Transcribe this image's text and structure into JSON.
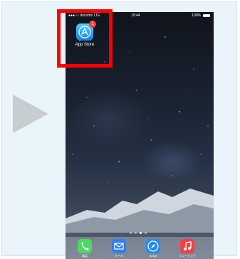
{
  "status": {
    "carrier": "●●●○○ docomo  LTE",
    "time": "19:44",
    "battery": "100%"
  },
  "app": {
    "label": "App Store",
    "badge": "1",
    "icon": "app-store-icon"
  },
  "dock": {
    "items": [
      {
        "label": "電話",
        "icon": "phone-icon",
        "color": "#4cd964"
      },
      {
        "label": "メール",
        "icon": "mail-icon",
        "color": "#2f7ef5"
      },
      {
        "label": "Safari",
        "icon": "compass-icon",
        "color": "#1e8cf0"
      },
      {
        "label": "ミュージック",
        "icon": "music-icon",
        "color": "#fc3c44"
      }
    ]
  },
  "colors": {
    "highlight": "#ff0000",
    "panel": "#eaf4fb",
    "arrow": "#c8cdd2"
  }
}
